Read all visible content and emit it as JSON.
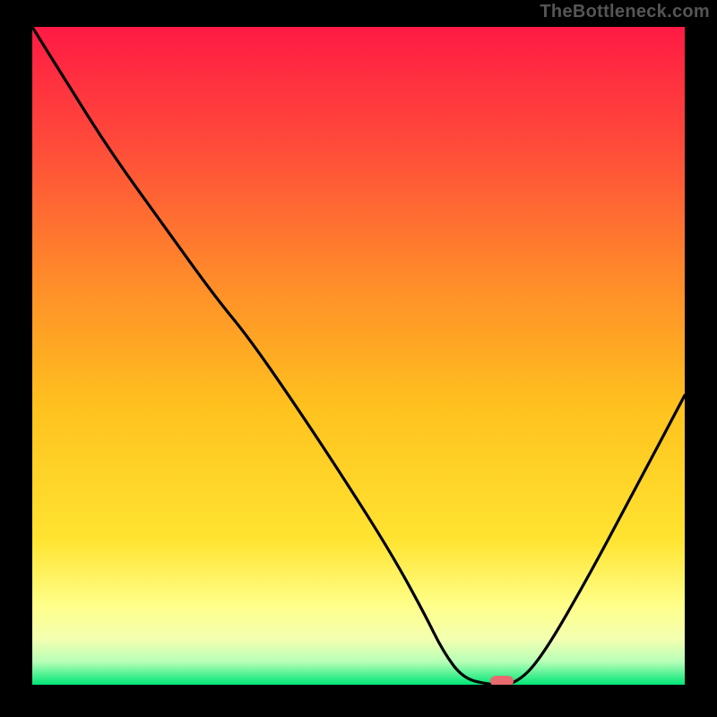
{
  "watermark": "TheBottleneck.com",
  "chart_data": {
    "type": "line",
    "title": "",
    "xlabel": "",
    "ylabel": "",
    "xlim": [
      0,
      100
    ],
    "ylim": [
      0,
      100
    ],
    "grid": false,
    "legend": false,
    "background_gradient": {
      "top_color": "#ff1a44",
      "mid_color": "#ffd400",
      "low_band_color": "#ffff9a",
      "bottom_color": "#00e676"
    },
    "series": [
      {
        "name": "bottleneck-curve",
        "color": "#000000",
        "x": [
          0,
          5,
          12,
          20,
          28,
          33,
          40,
          48,
          55,
          60,
          63,
          66,
          70,
          74,
          78,
          85,
          92,
          100
        ],
        "y": [
          100,
          92,
          81,
          70,
          59,
          53,
          43,
          31,
          20,
          11,
          5,
          1,
          0,
          0,
          4,
          16,
          29,
          44
        ]
      }
    ],
    "marker": {
      "x": 72,
      "y": 0.5,
      "color": "#e86a6f"
    }
  }
}
